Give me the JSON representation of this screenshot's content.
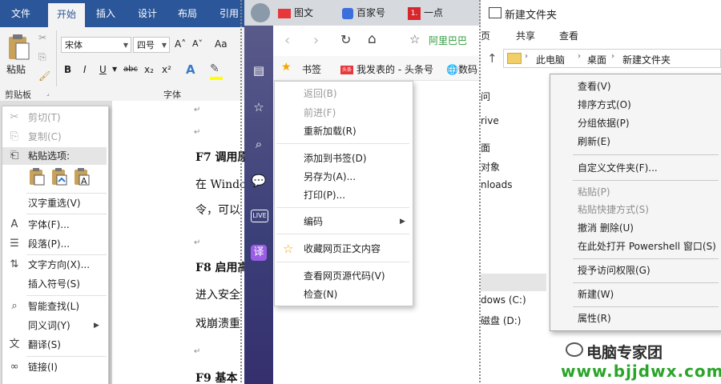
{
  "word": {
    "tabs": [
      "文件",
      "开始",
      "插入",
      "设计",
      "布局",
      "引用"
    ],
    "font_name": "宋体",
    "font_size": "四号",
    "paste_label": "粘贴",
    "clipboard_label": "剪贴板",
    "font_group_label": "字体",
    "format_buttons": [
      "B",
      "I",
      "U",
      "abc",
      "x₂",
      "x²"
    ],
    "grow_font": "A˄",
    "shrink_font": "A˅",
    "change_case": "Aa",
    "doc_lines": [
      {
        "text": "F7 调用原",
        "bold": true
      },
      {
        "text": "在 Windo",
        "bold": false
      },
      {
        "text": "令，可以",
        "bold": false
      },
      {
        "text": "F8 启用高",
        "bold": true
      },
      {
        "text": "进入安全",
        "bold": false
      },
      {
        "text": "戏崩溃重",
        "bold": false
      },
      {
        "text": "F9 基本",
        "bold": true
      }
    ],
    "context_menu": {
      "items": [
        {
          "label": "剪切(T)",
          "icon": "scissors-icon",
          "glyph": "✂",
          "disabled": true
        },
        {
          "label": "复制(C)",
          "icon": "copy-icon",
          "glyph": "⎘",
          "disabled": true
        },
        {
          "label": "粘贴选项:",
          "icon": "paste-icon",
          "glyph": "📋",
          "disabled": false,
          "highlight": true
        },
        {
          "label": "汉字重选(V)",
          "icon": "",
          "glyph": "",
          "disabled": false
        },
        {
          "label": "字体(F)...",
          "icon": "font-icon",
          "glyph": "A",
          "disabled": false
        },
        {
          "label": "段落(P)...",
          "icon": "paragraph-icon",
          "glyph": "☰",
          "disabled": false
        },
        {
          "label": "文字方向(X)...",
          "icon": "text-direction-icon",
          "glyph": "⇅",
          "disabled": false
        },
        {
          "label": "插入符号(S)",
          "icon": "",
          "glyph": "",
          "disabled": false
        },
        {
          "label": "智能查找(L)",
          "icon": "smart-lookup-icon",
          "glyph": "⌕",
          "disabled": false
        },
        {
          "label": "同义词(Y)",
          "icon": "",
          "glyph": "",
          "disabled": false,
          "submenu": true
        },
        {
          "label": "翻译(S)",
          "icon": "translate-icon",
          "glyph": "文",
          "disabled": false
        },
        {
          "label": "链接(I)",
          "icon": "link-icon",
          "glyph": "∞",
          "disabled": false
        }
      ]
    }
  },
  "browser": {
    "tabs": [
      {
        "label": "图文",
        "icon": "toutiao-icon"
      },
      {
        "label": "百家号",
        "icon": "baijiahao-icon"
      },
      {
        "label": "一点",
        "icon": "yidian-icon"
      }
    ],
    "tab_badge": "1.",
    "address_hint": "阿里巴巴",
    "bookmarks_label": "书签",
    "bookmark_items": [
      "我发表的 - 头条号",
      "数码"
    ],
    "bookmark_badge": "头条",
    "sidebar_live": "LIVE",
    "sidebar_translate": "译",
    "context_menu": {
      "items": [
        {
          "label": "返回(B)",
          "disabled": true
        },
        {
          "label": "前进(F)",
          "disabled": true
        },
        {
          "label": "重新加载(R)",
          "disabled": false
        },
        {
          "label": "添加到书签(D)",
          "disabled": false
        },
        {
          "label": "另存为(A)...",
          "disabled": false
        },
        {
          "label": "打印(P)...",
          "disabled": false
        },
        {
          "label": "编码",
          "disabled": false,
          "submenu": true
        },
        {
          "label": "收藏网页正文内容",
          "disabled": false,
          "star": true
        },
        {
          "label": "查看网页源代码(V)",
          "disabled": false
        },
        {
          "label": "检查(N)",
          "disabled": false
        }
      ]
    }
  },
  "explorer": {
    "title": "新建文件夹",
    "ribbon_tabs": [
      "页",
      "共享",
      "查看"
    ],
    "breadcrumb": [
      "此电脑",
      "桌面",
      "新建文件夹"
    ],
    "nav_items": [
      "问",
      "rive",
      "面",
      "对象",
      "nloads",
      "dows (C:)",
      "磁盘 (D:)"
    ],
    "context_menu": {
      "items": [
        {
          "label": "查看(V)",
          "disabled": false
        },
        {
          "label": "排序方式(O)",
          "disabled": false
        },
        {
          "label": "分组依据(P)",
          "disabled": false
        },
        {
          "label": "刷新(E)",
          "disabled": false
        },
        {
          "label": "自定义文件夹(F)...",
          "disabled": false
        },
        {
          "label": "粘贴(P)",
          "disabled": true
        },
        {
          "label": "粘贴快捷方式(S)",
          "disabled": true
        },
        {
          "label": "撤消 删除(U)",
          "disabled": false
        },
        {
          "label": "在此处打开 Powershell 窗口(S)",
          "disabled": false
        },
        {
          "label": "授予访问权限(G)",
          "disabled": false
        },
        {
          "label": "新建(W)",
          "disabled": false
        },
        {
          "label": "属性(R)",
          "disabled": false
        }
      ]
    }
  },
  "watermark": {
    "line1": "电脑专家团",
    "line2": "www.bjjdwx.com"
  },
  "colors": {
    "word_blue": "#2b579a",
    "browser_sidebar": "#3b3f78",
    "watermark_green": "#2aa52a"
  }
}
